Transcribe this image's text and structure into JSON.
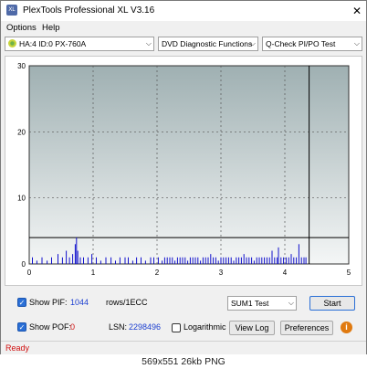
{
  "window": {
    "title": "PlexTools Professional XL V3.16",
    "app_icon_text": "XL"
  },
  "menu": {
    "options": "Options",
    "help": "Help"
  },
  "toolbar": {
    "drive": "HA:4 ID:0  PX-760A",
    "function": "DVD Diagnostic Functions",
    "test": "Q-Check PI/PO Test"
  },
  "chart_data": {
    "type": "bar",
    "xlim": [
      0,
      5
    ],
    "ylim": [
      0,
      30
    ],
    "x_ticks": [
      "0",
      "1",
      "2",
      "3",
      "4",
      "5"
    ],
    "y_ticks": [
      "0",
      "10",
      "20",
      "30"
    ],
    "threshold": 4,
    "end_marker_x": 4.38,
    "grid": true,
    "series": [
      {
        "color": "#1010cc",
        "points": [
          [
            0.05,
            1
          ],
          [
            0.12,
            0.5
          ],
          [
            0.2,
            1
          ],
          [
            0.28,
            0.5
          ],
          [
            0.35,
            1
          ],
          [
            0.45,
            1.5
          ],
          [
            0.52,
            1
          ],
          [
            0.58,
            2
          ],
          [
            0.63,
            1
          ],
          [
            0.68,
            1.5
          ],
          [
            0.72,
            3
          ],
          [
            0.74,
            4
          ],
          [
            0.76,
            2
          ],
          [
            0.8,
            1
          ],
          [
            0.85,
            1
          ],
          [
            0.92,
            1
          ],
          [
            0.98,
            1.5
          ],
          [
            1.05,
            1
          ],
          [
            1.12,
            0.5
          ],
          [
            1.2,
            1
          ],
          [
            1.28,
            1
          ],
          [
            1.35,
            0.5
          ],
          [
            1.42,
            1
          ],
          [
            1.5,
            1
          ],
          [
            1.55,
            1
          ],
          [
            1.62,
            0.5
          ],
          [
            1.68,
            1
          ],
          [
            1.75,
            1
          ],
          [
            1.82,
            0.5
          ],
          [
            1.9,
            1
          ],
          [
            1.95,
            1
          ],
          [
            2.02,
            1
          ],
          [
            2.08,
            0.5
          ],
          [
            2.12,
            1
          ],
          [
            2.16,
            1
          ],
          [
            2.2,
            1
          ],
          [
            2.24,
            1
          ],
          [
            2.28,
            0.5
          ],
          [
            2.32,
            1
          ],
          [
            2.36,
            1
          ],
          [
            2.4,
            1
          ],
          [
            2.44,
            1
          ],
          [
            2.48,
            0.5
          ],
          [
            2.52,
            1
          ],
          [
            2.56,
            1
          ],
          [
            2.6,
            1
          ],
          [
            2.64,
            1
          ],
          [
            2.68,
            0.5
          ],
          [
            2.72,
            1
          ],
          [
            2.76,
            1
          ],
          [
            2.8,
            1
          ],
          [
            2.84,
            1.5
          ],
          [
            2.88,
            1
          ],
          [
            2.92,
            1
          ],
          [
            2.96,
            0.5
          ],
          [
            3.0,
            1
          ],
          [
            3.04,
            1
          ],
          [
            3.08,
            1
          ],
          [
            3.12,
            1
          ],
          [
            3.16,
            1
          ],
          [
            3.2,
            0.5
          ],
          [
            3.24,
            1
          ],
          [
            3.28,
            1
          ],
          [
            3.32,
            1
          ],
          [
            3.36,
            1.5
          ],
          [
            3.4,
            1
          ],
          [
            3.44,
            1
          ],
          [
            3.48,
            1
          ],
          [
            3.52,
            0.5
          ],
          [
            3.56,
            1
          ],
          [
            3.6,
            1
          ],
          [
            3.64,
            1
          ],
          [
            3.68,
            1
          ],
          [
            3.72,
            1
          ],
          [
            3.76,
            1
          ],
          [
            3.8,
            2
          ],
          [
            3.84,
            1
          ],
          [
            3.88,
            1
          ],
          [
            3.9,
            2.5
          ],
          [
            3.94,
            1
          ],
          [
            3.98,
            1
          ],
          [
            4.02,
            1
          ],
          [
            4.06,
            1
          ],
          [
            4.1,
            1.5
          ],
          [
            4.14,
            1
          ],
          [
            4.18,
            1
          ],
          [
            4.22,
            3
          ],
          [
            4.26,
            1
          ],
          [
            4.3,
            1
          ],
          [
            4.33,
            1
          ]
        ]
      }
    ]
  },
  "bottom": {
    "show_pif_label": "Show PIF:",
    "pif_value": "1044",
    "rows_label": "rows/1ECC",
    "show_pof_label": "Show POF:",
    "pof_value": "0",
    "lsn_label": "LSN:",
    "lsn_value": "2298496",
    "logarithmic_label": "Logarithmic",
    "sum_select": "SUM1 Test",
    "start_label": "Start",
    "view_log_label": "View Log",
    "preferences_label": "Preferences",
    "info_icon_text": "i"
  },
  "status": {
    "text": "Ready"
  },
  "caption": "569x551  26kb  PNG"
}
